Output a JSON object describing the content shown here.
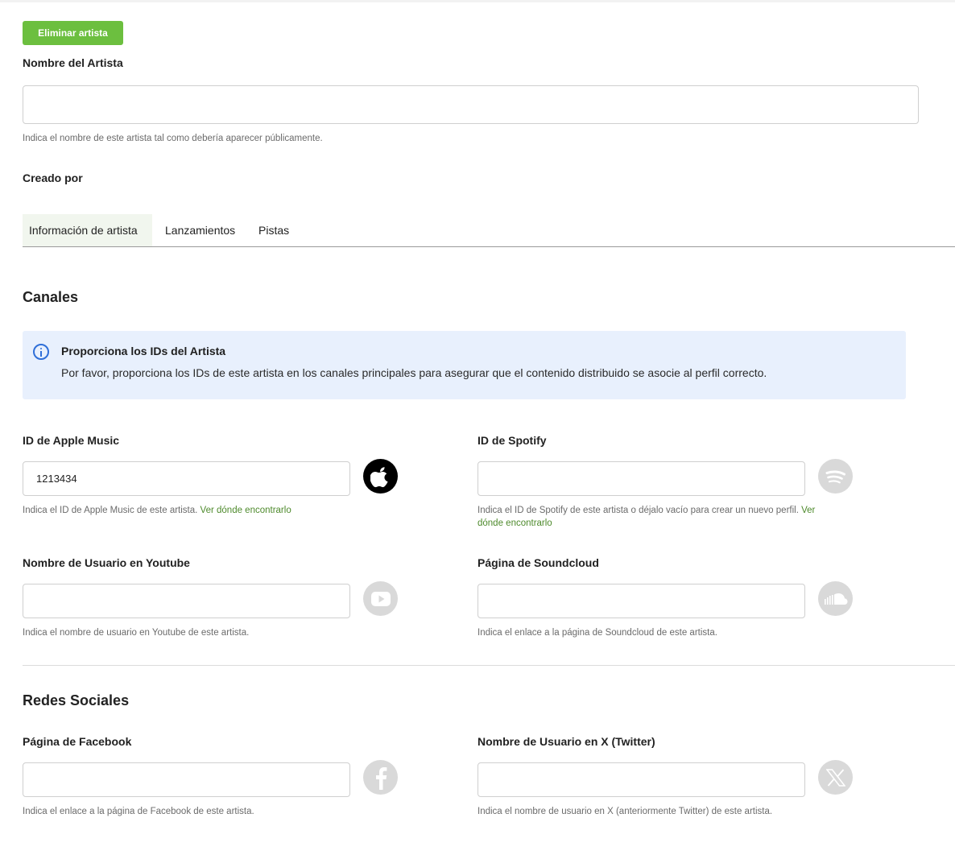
{
  "actions": {
    "delete_artist": "Eliminar artista"
  },
  "artist_name": {
    "label": "Nombre del Artista",
    "value": "",
    "help": "Indica el nombre de este artista tal como debería aparecer públicamente."
  },
  "created_by": {
    "label": "Creado por"
  },
  "tabs": [
    {
      "label": "Información de artista",
      "active": true
    },
    {
      "label": "Lanzamientos",
      "active": false
    },
    {
      "label": "Pistas",
      "active": false
    }
  ],
  "channels": {
    "title": "Canales",
    "info": {
      "title": "Proporciona los IDs del Artista",
      "text": "Por favor, proporciona los IDs de este artista en los canales principales para asegurar que el contenido distribuido se asocie al perfil correcto."
    },
    "apple_music": {
      "label": "ID de Apple Music",
      "value": "1213434",
      "help": "Indica el ID de Apple Music de este artista.",
      "link": "Ver dónde encontrarlo",
      "icon": "apple-music-icon"
    },
    "spotify": {
      "label": "ID de Spotify",
      "value": "",
      "help": "Indica el ID de Spotify de este artista o déjalo vacío para crear un nuevo perfil.",
      "link": "Ver dónde encontrarlo",
      "icon": "spotify-icon"
    },
    "youtube": {
      "label": "Nombre de Usuario en Youtube",
      "value": "",
      "help": "Indica el nombre de usuario en Youtube de este artista.",
      "icon": "youtube-icon"
    },
    "soundcloud": {
      "label": "Página de Soundcloud",
      "value": "",
      "help": "Indica el enlace a la página de Soundcloud de este artista.",
      "icon": "soundcloud-icon"
    }
  },
  "social": {
    "title": "Redes Sociales",
    "facebook": {
      "label": "Página de Facebook",
      "value": "",
      "help": "Indica el enlace a la página de Facebook de este artista.",
      "icon": "facebook-icon"
    },
    "twitter": {
      "label": "Nombre de Usuario en X (Twitter)",
      "value": "",
      "help": "Indica el nombre de usuario en X (anteriormente Twitter) de este artista.",
      "icon": "x-twitter-icon"
    }
  },
  "colors": {
    "accent_green": "#6cbf3f",
    "link_green": "#4e8a2c",
    "info_bg": "#e8f0fd",
    "info_icon": "#2f6fd8"
  }
}
